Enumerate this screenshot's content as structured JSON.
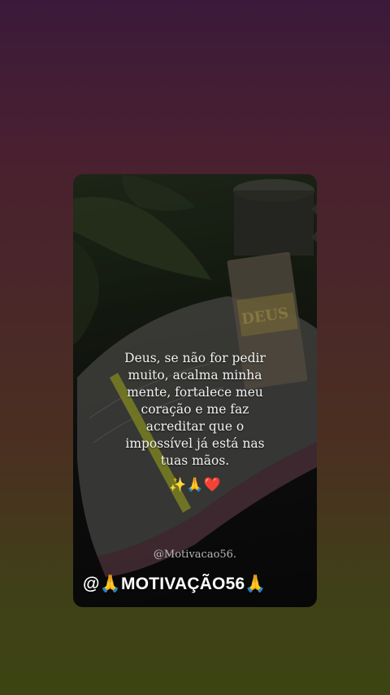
{
  "story": {
    "quote": "Deus, se não for pedir muito, acalma minha mente, fortalece meu coração e me faz acreditar que o impossível já está nas tuas mãos.",
    "emojis": "✨🙏❤️",
    "watermark": "@Motivacao56.",
    "handle": "@🙏MOTIVAÇÃO56🙏",
    "book_cover_text": "DEUS"
  },
  "colors": {
    "background_top": "#3a1a3a",
    "background_bottom": "#3c4412",
    "text": "#f2f2f2",
    "highlighter": "#c8d232"
  }
}
